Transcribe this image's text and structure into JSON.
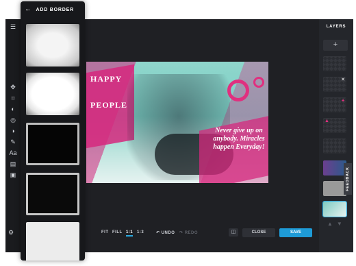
{
  "panel": {
    "back_icon": "arrow-left-icon",
    "title": "ADD BORDER",
    "borders": [
      "grunge-frame",
      "white-rough-frame",
      "black-rough-frame",
      "black-clean-frame",
      "light-frame"
    ]
  },
  "toolbar": {
    "icons": [
      "menu-icon",
      "move-icon",
      "crop-icon",
      "adjust-icon",
      "filter-icon",
      "contrast-icon",
      "brush-icon",
      "text-icon",
      "layers-icon",
      "image-icon"
    ],
    "settings_icon": "settings-icon"
  },
  "canvas": {
    "text_happy": "HAPPY",
    "text_people": "PEOPLE",
    "quote": "Never give up on anybody. Miracles happen Everyday!"
  },
  "bottom_bar": {
    "zoom_options": [
      "FIT",
      "FILL",
      "1:1",
      "1:3"
    ],
    "active_zoom": "1:1",
    "undo": "UNDO",
    "redo": "REDO",
    "close": "CLOSE",
    "save": "SAVE"
  },
  "layers_panel": {
    "title": "LAYERS",
    "add_label": "+",
    "feedback": "FEEDBACK"
  },
  "colors": {
    "accent": "#1e9bd7",
    "magenta": "#e0307f",
    "background": "#1f2024"
  }
}
